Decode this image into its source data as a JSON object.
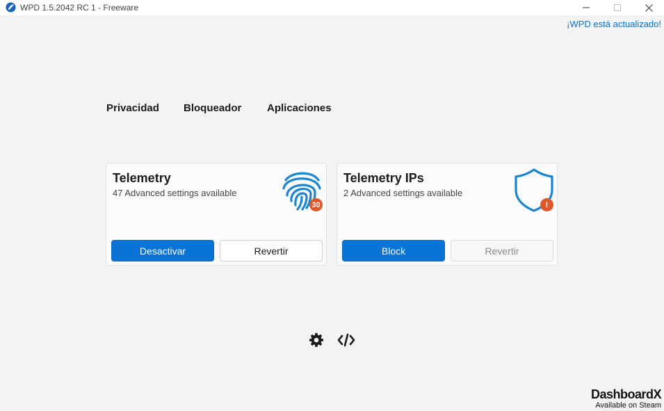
{
  "window": {
    "title": "WPD 1.5.2042 RC 1 - Freeware",
    "update_status": "¡WPD está actualizado!"
  },
  "nav": {
    "tabs": [
      {
        "label": "Privacidad"
      },
      {
        "label": "Bloqueador"
      },
      {
        "label": "Aplicaciones"
      }
    ]
  },
  "cards": [
    {
      "title": "Telemetry",
      "subtitle": "47 Advanced settings available",
      "icon": "fingerprint-icon",
      "badge": "30",
      "primary_label": "Desactivar",
      "secondary_label": "Revertir",
      "secondary_disabled": false
    },
    {
      "title": "Telemetry IPs",
      "subtitle": "2 Advanced settings available",
      "icon": "shield-icon",
      "badge": "!",
      "primary_label": "Block",
      "secondary_label": "Revertir",
      "secondary_disabled": true
    }
  ],
  "footer": {
    "icons": [
      "gear-icon",
      "code-icon"
    ],
    "brand_name": "DashboardX",
    "brand_sub": "Available on Steam"
  },
  "colors": {
    "accent": "#0a74d6",
    "badge": "#e0572a",
    "icon_blue": "#1a86d0",
    "link": "#0a74c9"
  }
}
